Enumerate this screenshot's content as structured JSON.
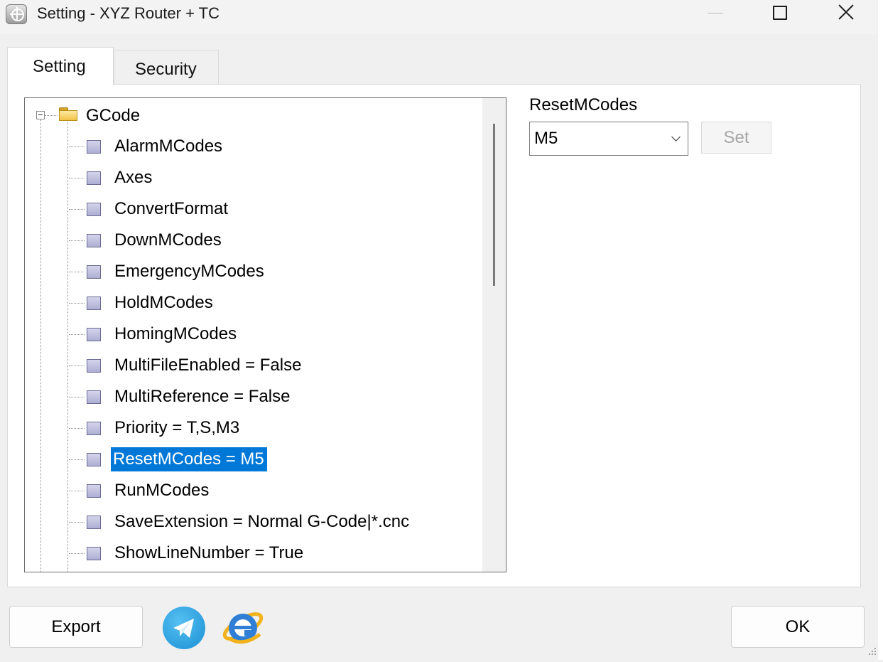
{
  "window": {
    "title": "Setting - XYZ Router + TC"
  },
  "tabs": [
    {
      "label": "Setting",
      "active": true
    },
    {
      "label": "Security",
      "active": false
    }
  ],
  "tree": {
    "root": {
      "label": "GCode",
      "expanded": true,
      "icon": "folder-icon"
    },
    "items": [
      {
        "label": "AlarmMCodes",
        "selected": false
      },
      {
        "label": "Axes",
        "selected": false
      },
      {
        "label": "ConvertFormat",
        "selected": false
      },
      {
        "label": "DownMCodes",
        "selected": false
      },
      {
        "label": "EmergencyMCodes",
        "selected": false
      },
      {
        "label": "HoldMCodes",
        "selected": false
      },
      {
        "label": "HomingMCodes",
        "selected": false
      },
      {
        "label": "MultiFileEnabled = False",
        "selected": false
      },
      {
        "label": "MultiReference = False",
        "selected": false
      },
      {
        "label": "Priority = T,S,M3",
        "selected": false
      },
      {
        "label": "ResetMCodes = M5",
        "selected": true
      },
      {
        "label": "RunMCodes",
        "selected": false
      },
      {
        "label": "SaveExtension = Normal G-Code|*.cnc",
        "selected": false
      },
      {
        "label": "ShowLineNumber = True",
        "selected": false
      }
    ],
    "item_icon": "property-icon"
  },
  "property_editor": {
    "label": "ResetMCodes",
    "value": "M5",
    "set_label": "Set",
    "set_enabled": false
  },
  "footer": {
    "export_label": "Export",
    "ok_label": "OK",
    "icons": [
      "telegram-icon",
      "internet-explorer-icon"
    ]
  },
  "colors": {
    "selection": "#0078d7",
    "window_bg": "#f0f0f0",
    "panel_bg": "#ffffff"
  }
}
